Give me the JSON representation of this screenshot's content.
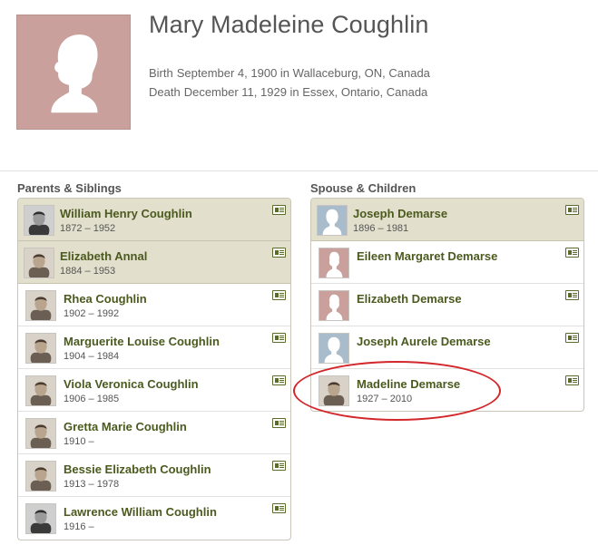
{
  "person": {
    "name": "Mary Madeleine Coughlin",
    "birth_label": "Birth",
    "birth_text": "September 4, 1900 in Wallaceburg, ON, Canada",
    "death_label": "Death",
    "death_text": "December 11, 1929 in Essex, Ontario, Canada"
  },
  "parents_siblings": {
    "title": "Parents & Siblings",
    "items": [
      {
        "name": "William Henry Coughlin",
        "dates": "1872 – 1952",
        "highlight": true,
        "photo": "man-portrait-photo"
      },
      {
        "name": "Elizabeth Annal",
        "dates": "1884 – 1953",
        "highlight": true,
        "photo": "woman-portrait-photo"
      },
      {
        "name": "Rhea Coughlin",
        "dates": "1902 – 1992",
        "highlight": false,
        "photo": "woman-portrait-photo"
      },
      {
        "name": "Marguerite Louise Coughlin",
        "dates": "1904 – 1984",
        "highlight": false,
        "photo": "woman-portrait-photo"
      },
      {
        "name": "Viola Veronica Coughlin",
        "dates": "1906 – 1985",
        "highlight": false,
        "photo": "woman-portrait-photo"
      },
      {
        "name": "Gretta Marie Coughlin",
        "dates": "1910 –",
        "highlight": false,
        "photo": "woman-portrait-photo"
      },
      {
        "name": "Bessie Elizabeth Coughlin",
        "dates": "1913 – 1978",
        "highlight": false,
        "photo": "woman-portrait-photo"
      },
      {
        "name": "Lawrence William Coughlin",
        "dates": "1916 –",
        "highlight": false,
        "photo": "man-portrait-photo"
      }
    ]
  },
  "spouse_children": {
    "title": "Spouse & Children",
    "items": [
      {
        "name": "Joseph Demarse",
        "dates": "1896 – 1981",
        "highlight": true,
        "photo": "male-silhouette"
      },
      {
        "name": "Eileen Margaret Demarse",
        "dates": "",
        "highlight": false,
        "photo": "female-silhouette"
      },
      {
        "name": "Elizabeth Demarse",
        "dates": "",
        "highlight": false,
        "photo": "female-silhouette"
      },
      {
        "name": "Joseph Aurele Demarse",
        "dates": "",
        "highlight": false,
        "photo": "male-silhouette"
      },
      {
        "name": "Madeline Demarse",
        "dates": "1927 – 2010",
        "highlight": false,
        "photo": "woman-portrait-photo"
      }
    ]
  },
  "colors": {
    "link_green": "#4b5a1e",
    "highlight_bg": "#e2dfcc",
    "female_silhouette_bg": "#c9a09c",
    "male_silhouette_bg": "#a9bccb",
    "annotation_red": "#d3282b"
  }
}
